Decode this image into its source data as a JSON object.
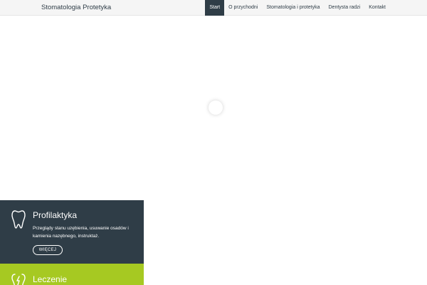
{
  "header": {
    "brand": "Stomatologia Protetyka",
    "nav": [
      {
        "label": "Start",
        "active": true
      },
      {
        "label": "O przychodni",
        "active": false
      },
      {
        "label": "Stomatologia i protetyka",
        "active": false
      },
      {
        "label": "Dentysta radzi",
        "active": false
      },
      {
        "label": "Kontakt",
        "active": false
      }
    ]
  },
  "services": [
    {
      "title": "Profilaktyka",
      "text": "Przeglądy stanu uzębienia, usuwanie osadów i kamienia nazębnego, instruktaż.",
      "button": "WIĘCEJ",
      "icon": "tooth-icon"
    },
    {
      "title": "Leczenie",
      "icon": "tooth-repair-icon"
    }
  ],
  "colors": {
    "nav_active_bg": "#2f3d47",
    "card_dark_bg": "#2f3d47",
    "card_green_bg": "#a6c922"
  }
}
